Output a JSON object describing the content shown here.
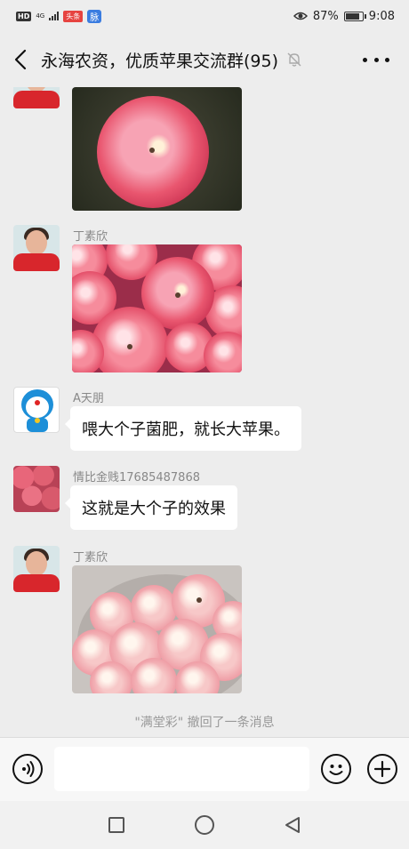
{
  "status_bar": {
    "hd": "HD",
    "network": "4G",
    "app_badge_1": "头条",
    "app_badge_2": "脉",
    "battery": "87%",
    "time": "9:08"
  },
  "title_bar": {
    "title": "永海农资，优质苹果交流群(95)",
    "icons": [
      "back-icon",
      "mute-bell-icon",
      "more-icon"
    ]
  },
  "messages": [
    {
      "type": "image",
      "sender": "",
      "avatar": "woman-avatar",
      "image": "single large pink apple"
    },
    {
      "type": "image",
      "sender": "丁素欣",
      "avatar": "woman-avatar",
      "image": "pile of pink apples"
    },
    {
      "type": "text",
      "sender": "A天朋",
      "avatar": "doraemon-avatar",
      "text": "喂大个子菌肥，就长大苹果。"
    },
    {
      "type": "text",
      "sender": "情比金贱17685487868",
      "avatar": "apples-avatar",
      "text": "这就是大个子的效果"
    },
    {
      "type": "image",
      "sender": "丁素欣",
      "avatar": "woman-avatar",
      "image": "basin of pale pink apples"
    }
  ],
  "recall_notice": {
    "text": "\"满堂彩\" 撤回了一条消息"
  },
  "input_bar": {
    "value": "",
    "icons": [
      "voice-icon",
      "emoji-icon",
      "plus-icon"
    ]
  },
  "nav_bar": {
    "icons": [
      "recents-icon",
      "home-icon",
      "back-nav-icon"
    ]
  }
}
